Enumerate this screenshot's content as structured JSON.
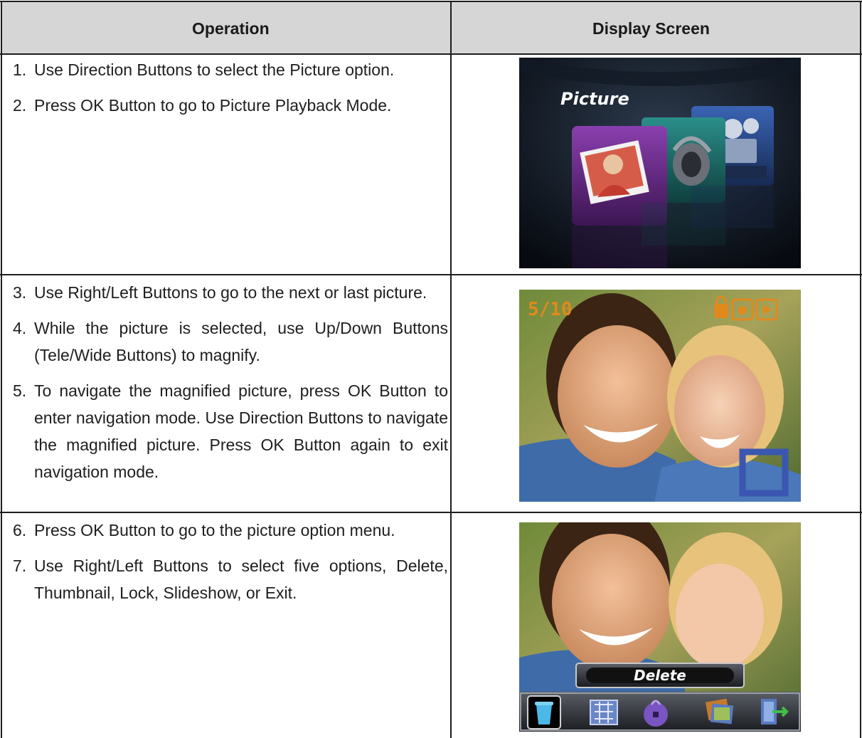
{
  "table": {
    "headers": {
      "operation": "Operation",
      "display": "Display Screen"
    },
    "rows": [
      {
        "steps": [
          {
            "num": "1.",
            "text": "Use Direction Buttons to select the Picture option."
          },
          {
            "num": "2.",
            "text": "Press OK Button to go to Picture Playback Mode."
          }
        ],
        "screen": {
          "label": "Picture",
          "icons": [
            "picture-icon",
            "music-icon",
            "video-icon"
          ]
        }
      },
      {
        "steps": [
          {
            "num": "3.",
            "text": "Use Right/Left Buttons to go to the next or last picture."
          },
          {
            "num": "4.",
            "text": "While the picture is selected, use Up/Down Buttons (Tele/Wide Buttons) to magnify."
          },
          {
            "num": "5.",
            "text": "To navigate the magnified picture, press OK Button to enter navigation mode. Use Direction Buttons to navigate the magnified picture. Press OK Button again to exit navigation mode."
          }
        ],
        "screen": {
          "counter": "5/10",
          "icons": [
            "lock-icon",
            "camera-mode-icon",
            "play-icon"
          ]
        }
      },
      {
        "steps": [
          {
            "num": "6.",
            "text": "Press OK Button to go to the picture option menu."
          },
          {
            "num": "7.",
            "text": "Use Right/Left Buttons to select five options, Delete, Thumbnail, Lock, Slideshow, or Exit."
          }
        ],
        "screen": {
          "menu_label": "Delete",
          "icons": [
            "trash-icon",
            "thumbnail-icon",
            "lock-icon",
            "slideshow-icon",
            "exit-icon"
          ]
        }
      }
    ]
  },
  "colors": {
    "header_bg": "#d6d6d6",
    "border": "#1e1e1e",
    "counter_orange": "#e08a1e"
  }
}
